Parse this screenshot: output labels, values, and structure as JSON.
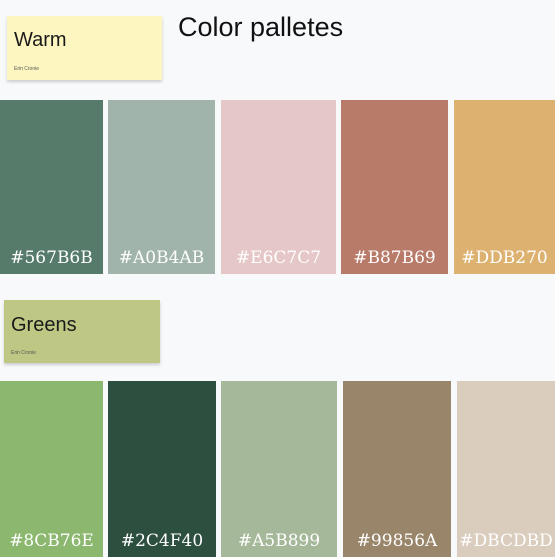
{
  "title": "Color palletes",
  "palettes": [
    {
      "name": "Warm",
      "author": "Erin Cronie",
      "note_color": "#FEF6C1",
      "swatches": [
        {
          "hex": "#567B6B",
          "color": "#567B6B"
        },
        {
          "hex": "#A0B4AB",
          "color": "#A0B4AB"
        },
        {
          "hex": "#E6C7C7",
          "color": "#E6C7C7"
        },
        {
          "hex": "#B87B69",
          "color": "#B87B69"
        },
        {
          "hex": "#DDB270",
          "color": "#DDB270"
        }
      ]
    },
    {
      "name": "Greens",
      "author": "Erin Cronie",
      "note_color": "#BEC884",
      "swatches": [
        {
          "hex": "#8CB76E",
          "color": "#8CB76E"
        },
        {
          "hex": "#2C4F40",
          "color": "#2C4F40"
        },
        {
          "hex": "#A5B899",
          "color": "#A5B899"
        },
        {
          "hex": "#99856A",
          "color": "#99856A"
        },
        {
          "hex": "#DBCDBD",
          "color": "#DBCDBD"
        }
      ]
    }
  ]
}
